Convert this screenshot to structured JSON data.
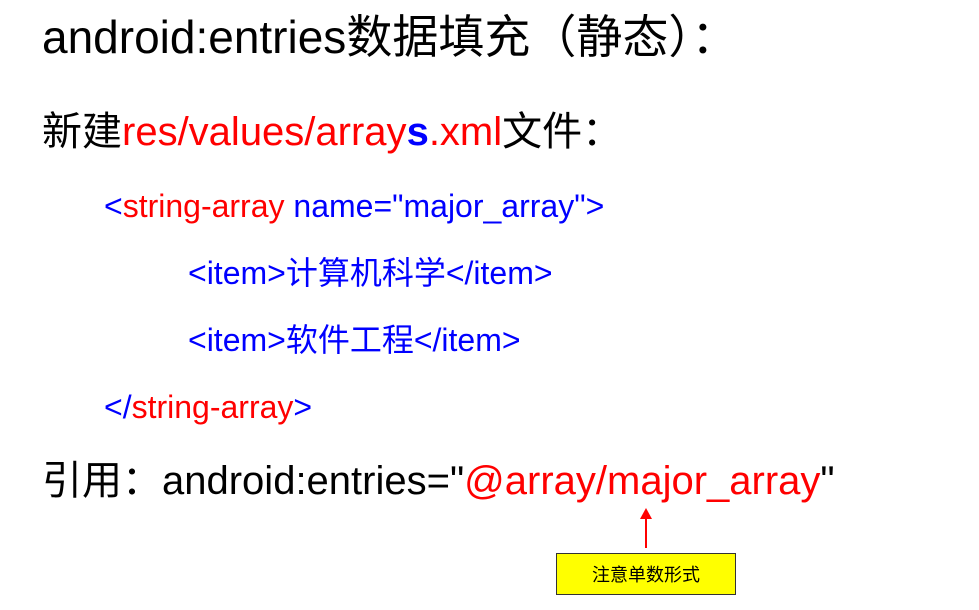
{
  "title": {
    "prefix": "android:entries",
    "suffix": "数据填充（静态）："
  },
  "create_line": {
    "prefix": "新建",
    "path_part1": "res/values/array",
    "path_s": "s",
    "path_ext": ".xml",
    "suffix": "文件："
  },
  "code": {
    "open_lt": "<",
    "open_tag": "string-array",
    "open_attr": " name=\"major_array\">",
    "item1_open": "<item>",
    "item1_text": "计算机科学",
    "item1_close": "</item>",
    "item2_open": "<item>",
    "item2_text": "软件工程",
    "item2_close": "</item>",
    "close_lt": "</",
    "close_tag": "string-array",
    "close_gt": ">"
  },
  "reference_line": {
    "label": "引用：",
    "attr": "android:entries=\"",
    "value": "@array/major_array",
    "end_quote": "\""
  },
  "note": {
    "text": "注意单数形式"
  },
  "colors": {
    "red": "#ff0000",
    "blue": "#0000ff",
    "note_background": "#ffff00"
  }
}
